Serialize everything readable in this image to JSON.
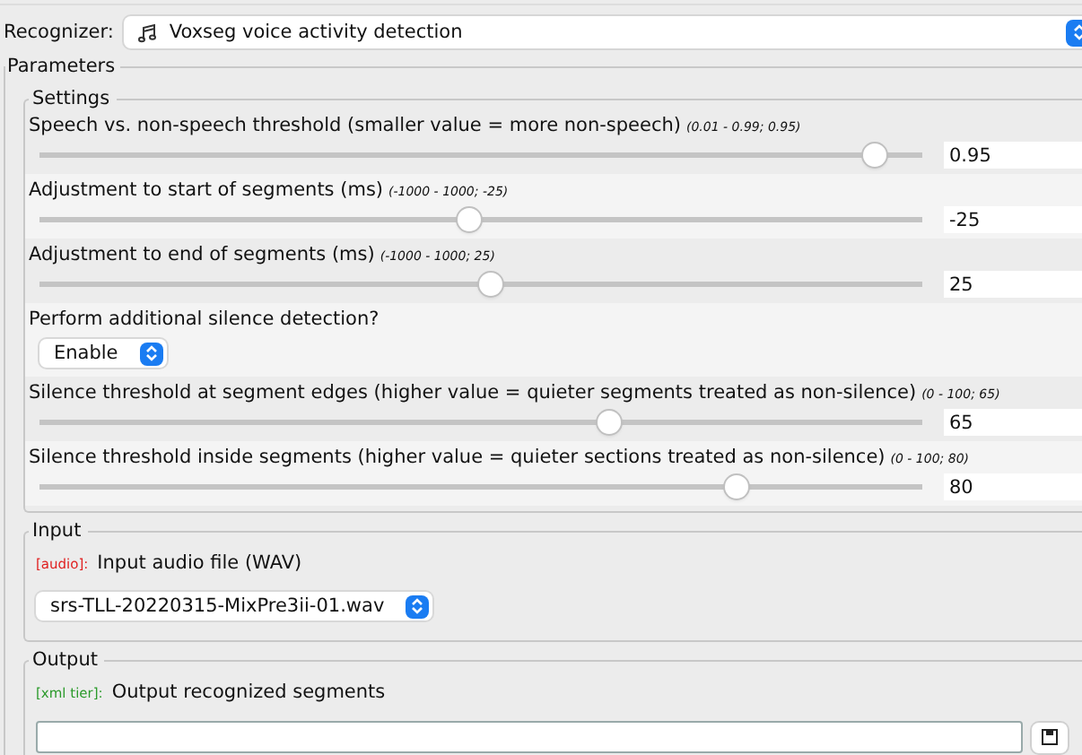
{
  "recognizer": {
    "label": "Recognizer:",
    "value": "Voxseg voice activity detection"
  },
  "parameters": {
    "title": "Parameters",
    "settings": {
      "title": "Settings",
      "rows": [
        {
          "kind": "slider",
          "label": "Speech vs. non-speech threshold (smaller value = more non-speech)",
          "range": "(0.01 - 0.99; 0.95)",
          "level": 0.96,
          "value": "0.95"
        },
        {
          "kind": "slider",
          "label": "Adjustment to start of segments (ms)",
          "range": "(-1000 - 1000; -25)",
          "level": 0.4875,
          "value": "-25"
        },
        {
          "kind": "slider",
          "label": "Adjustment to end of segments (ms)",
          "range": "(-1000 - 1000; 25)",
          "level": 0.5125,
          "value": "25"
        },
        {
          "kind": "select",
          "label": "Perform additional silence detection?",
          "value": "Enable"
        },
        {
          "kind": "slider",
          "label": "Silence threshold at segment edges (higher value = quieter segments treated as non-silence)",
          "range": "(0 - 100; 65)",
          "level": 0.65,
          "value": "65"
        },
        {
          "kind": "slider",
          "label": "Silence threshold inside segments (higher value = quieter sections treated as non-silence)",
          "range": "(0 - 100; 80)",
          "level": 0.8,
          "value": "80"
        }
      ]
    },
    "input": {
      "title": "Input",
      "tag": {
        "text": "[audio]:",
        "color": "#e02020"
      },
      "label": "Input audio file (WAV)",
      "file": "srs-TLL-20220315-MixPre3ii-01.wav"
    },
    "output": {
      "title": "Output",
      "tag": {
        "text": "[xml tier]:",
        "color": "#2a9a2a"
      },
      "label": "Output recognized segments"
    }
  }
}
